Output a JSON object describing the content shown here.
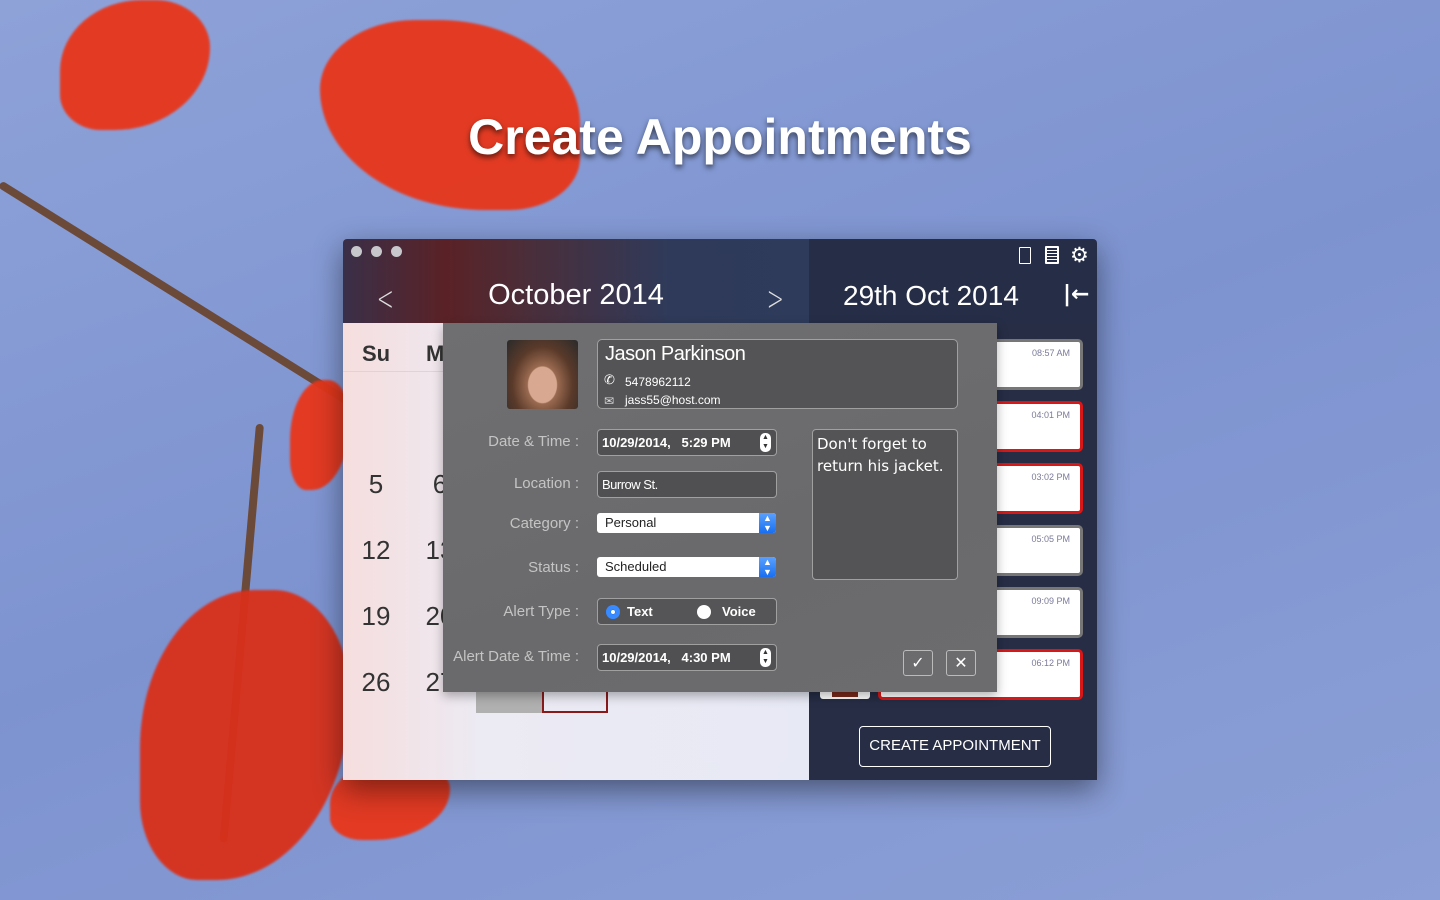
{
  "page_title": "Create Appointments",
  "header": {
    "month": "October 2014",
    "selected_date": "29th Oct 2014"
  },
  "calendar": {
    "weekdays": [
      "Su",
      "M"
    ],
    "rows": [
      [
        "",
        ""
      ],
      [
        "5",
        "6"
      ],
      [
        "12",
        "13"
      ],
      [
        "19",
        "20"
      ],
      [
        "26",
        "27"
      ]
    ]
  },
  "appointments": [
    {
      "time": "08:57 AM",
      "highlight": false
    },
    {
      "time": "04:01 PM",
      "highlight": true
    },
    {
      "time": "03:02 PM",
      "highlight": true
    },
    {
      "time": "05:05 PM",
      "highlight": false
    },
    {
      "time": "09:09 PM",
      "highlight": false
    },
    {
      "time": "06:12 PM",
      "highlight": true
    }
  ],
  "create_button": "CREATE APPOINTMENT",
  "form": {
    "contact": {
      "name": "Jason Parkinson",
      "phone": "5478962112",
      "email": "jass55@host.com"
    },
    "labels": {
      "date_time": "Date & Time :",
      "location": "Location :",
      "category": "Category :",
      "status": "Status :",
      "alert_type": "Alert Type :",
      "alert_date_time": "Alert Date & Time :"
    },
    "date_time": "10/29/2014,   5:29 PM",
    "location": "Burrow St.",
    "category": "Personal",
    "status": "Scheduled",
    "alert_type_options": [
      "Text",
      "Voice"
    ],
    "alert_type_selected": "Text",
    "alert_date_time": "10/29/2014,   4:30 PM",
    "notes": "Don't forget to return his jacket."
  },
  "colors": {
    "accent_red": "#d81818",
    "header_navy": "#262d47",
    "radio_blue": "#1a6ff0"
  }
}
